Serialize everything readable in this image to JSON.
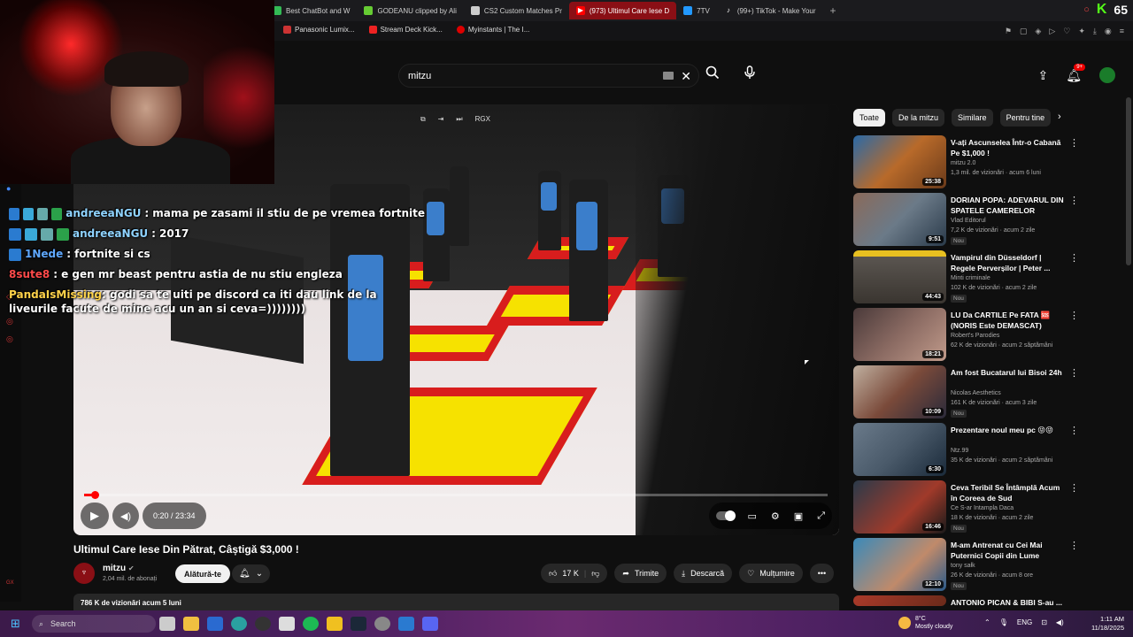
{
  "browser": {
    "tabs": [
      {
        "label": "Best ChatBot and W",
        "color": "#3b5"
      },
      {
        "label": "GODEANU clipped by Ali",
        "color": "#6c3"
      },
      {
        "label": "CS2 Custom Matches Pr",
        "color": "#ccc"
      },
      {
        "label": "(973) Ultimul Care Iese D",
        "color": "#f00",
        "active": true
      },
      {
        "label": "7TV",
        "color": "#29f"
      },
      {
        "label": "(99+) TikTok - Make Your",
        "color": "#eee"
      }
    ],
    "kick_count": "65",
    "bookmarks": [
      {
        "label": "Panasonic Lumix...",
        "color": "#c33"
      },
      {
        "label": "Stream Deck Kick...",
        "color": "#e22"
      },
      {
        "label": "Myinstants | The I...",
        "color": "#d00"
      }
    ]
  },
  "youtube": {
    "search_query": "mitzu",
    "notification_count": "9+"
  },
  "chat": [
    {
      "user": "andreeaNGU",
      "user_color": "#8fd3ff",
      "message": "mama pe zasami il stiu de pe vremea fortnite"
    },
    {
      "user": "andreeaNGU",
      "user_color": "#8fd3ff",
      "message": "2017"
    },
    {
      "user": "1Nede",
      "user_color": "#5fa8ff",
      "message": "fortnite si cs"
    },
    {
      "user": "8sute8",
      "user_color": "#ff4a4a",
      "message": "e gen mr beast pentru astia de nu stiu engleza"
    },
    {
      "user": "PandaIsMissing",
      "user_color": "#ffd24a",
      "message": "godi sa te uiti pe discord ca iti dau link de la liveurile facute de mine acu un an si ceva=))))))))"
    }
  ],
  "player": {
    "time": "0:20 / 23:34",
    "progress_fraction": 0.014,
    "top_label": "RGX"
  },
  "video": {
    "title": "Ultimul Care Iese Din Pătrat, Câștigă $3,000 !",
    "channel": "mitzu",
    "subscribers": "2,04 mil. de abonați",
    "join_label": "Alătură-te",
    "likes": "17 K",
    "share_label": "Trimite",
    "download_label": "Descarcă",
    "thanks_label": "Mulțumire",
    "views_line": "786 K de vizionări  acum 5 luni"
  },
  "sidebar": {
    "chips": [
      "Toate",
      "De la mitzu",
      "Similare",
      "Pentru tine"
    ],
    "recommendations": [
      {
        "title": "V-ați Ascunselea Într-o Cabană Pe $1,000 !",
        "channel": "mitzu 2.0",
        "meta": "1,3 mil. de vizionări · acum 6 luni",
        "duration": "25:38",
        "badge": "",
        "thumb": "#b86a2a"
      },
      {
        "title": "DORIAN POPA: ADEVARUL DIN SPATELE CAMERELOR",
        "channel": "Vlad Editorul",
        "meta": "7,2 K de vizionări · acum 2 zile",
        "duration": "9:51",
        "badge": "Nou",
        "thumb": "#6b7a88"
      },
      {
        "title": "Vampirul din Düsseldorf | Regele Perverșilor | Peter ...",
        "channel": "Minti criminale",
        "meta": "102 K de vizionări · acum 2 zile",
        "duration": "44:43",
        "badge": "Nou",
        "thumb": "#5a5550"
      },
      {
        "title": "LU Da CARTILE Pe FATA 🆘 (NORIS Este DEMASCAT)",
        "channel": "Robert's Parodies",
        "meta": "62 K de vizionări · acum 2 săptămâni",
        "duration": "18:21",
        "badge": "",
        "thumb": "#8a6a62"
      },
      {
        "title": "Am fost Bucatarul lui Bisoi 24h",
        "channel": "Nicolas Aesthetics",
        "meta": "161 K de vizionări · acum 3 zile",
        "duration": "10:09",
        "badge": "Nou",
        "thumb": "#7a4a3a"
      },
      {
        "title": "Prezentare noul meu pc 😝😝",
        "channel": "Ntz.99",
        "meta": "35 K de vizionări · acum 2 săptămâni",
        "duration": "6:30",
        "badge": "",
        "thumb": "#4a5a6a"
      },
      {
        "title": "Ceva Teribil Se Întâmplă Acum în Coreea de Sud",
        "channel": "Ce S-ar Intampla Daca",
        "meta": "18 K de vizionări · acum 2 zile",
        "duration": "16:46",
        "badge": "Nou",
        "thumb": "#a03a2a"
      },
      {
        "title": "M-am Antrenat cu Cei Mai Puternici Copii din Lume (Frați...",
        "channel": "tony sałk",
        "meta": "26 K de vizionări · acum 8 ore",
        "duration": "12:10",
        "badge": "Nou",
        "thumb": "#3a8aba"
      },
      {
        "title": "ANTONIO PICAN & BIBI S-au ...",
        "channel": "",
        "meta": "",
        "duration": "",
        "badge": "",
        "thumb": "#aa3a2a"
      }
    ]
  },
  "taskbar": {
    "search_label": "Search",
    "temperature": "8°C",
    "weather_desc": "Mostly cloudy",
    "lang": "ENG",
    "time": "1:11 AM",
    "date": "11/18/2025"
  }
}
